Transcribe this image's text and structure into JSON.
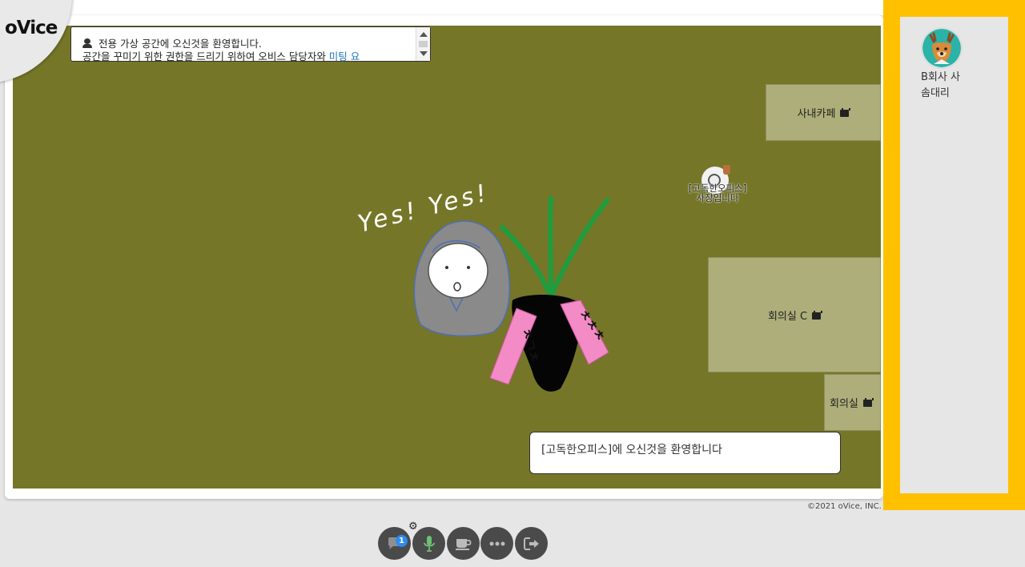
{
  "app": {
    "logo": "oVice"
  },
  "notice": {
    "line1": "전용 가상 공간에 오신것을 환영합니다.",
    "line2": "공간을 꾸미기 위한 권한을 드리기 위하여 오비스 담당자와 ",
    "link": "미팅 요"
  },
  "rooms": {
    "cafe": "사내카페",
    "room_c": "회의실 C",
    "room_small": "회의실"
  },
  "space_user": {
    "line1": "[고독한오피스]",
    "line2": "사장입니다"
  },
  "welcome_message": "[고독한오피스]에 오신것을 환영합니다",
  "drawing": {
    "handwriting": "Yes! Yes!",
    "ribbon_left": "ㅊㄱㅊ",
    "ribbon_right": "ㅊㅊㅊ"
  },
  "copyright": "©2021 oVice, INC.",
  "member_panel": {
    "members": [
      {
        "name": "B회사 사\n솜대리",
        "line1": "B회사 사",
        "line2": "솜대리"
      }
    ]
  },
  "toolbar": {
    "chat_badge": "1",
    "icons": [
      "chat-icon",
      "mic-icon",
      "coffee-icon",
      "more-icon",
      "exit-icon"
    ]
  },
  "colors": {
    "space_bg": "#757628",
    "room_bg": "#aeae7a",
    "panel_accent": "#ffc000",
    "toolbar_btn": "#4a4a4a",
    "link": "#1e73be",
    "badge": "#2c8cf0"
  }
}
